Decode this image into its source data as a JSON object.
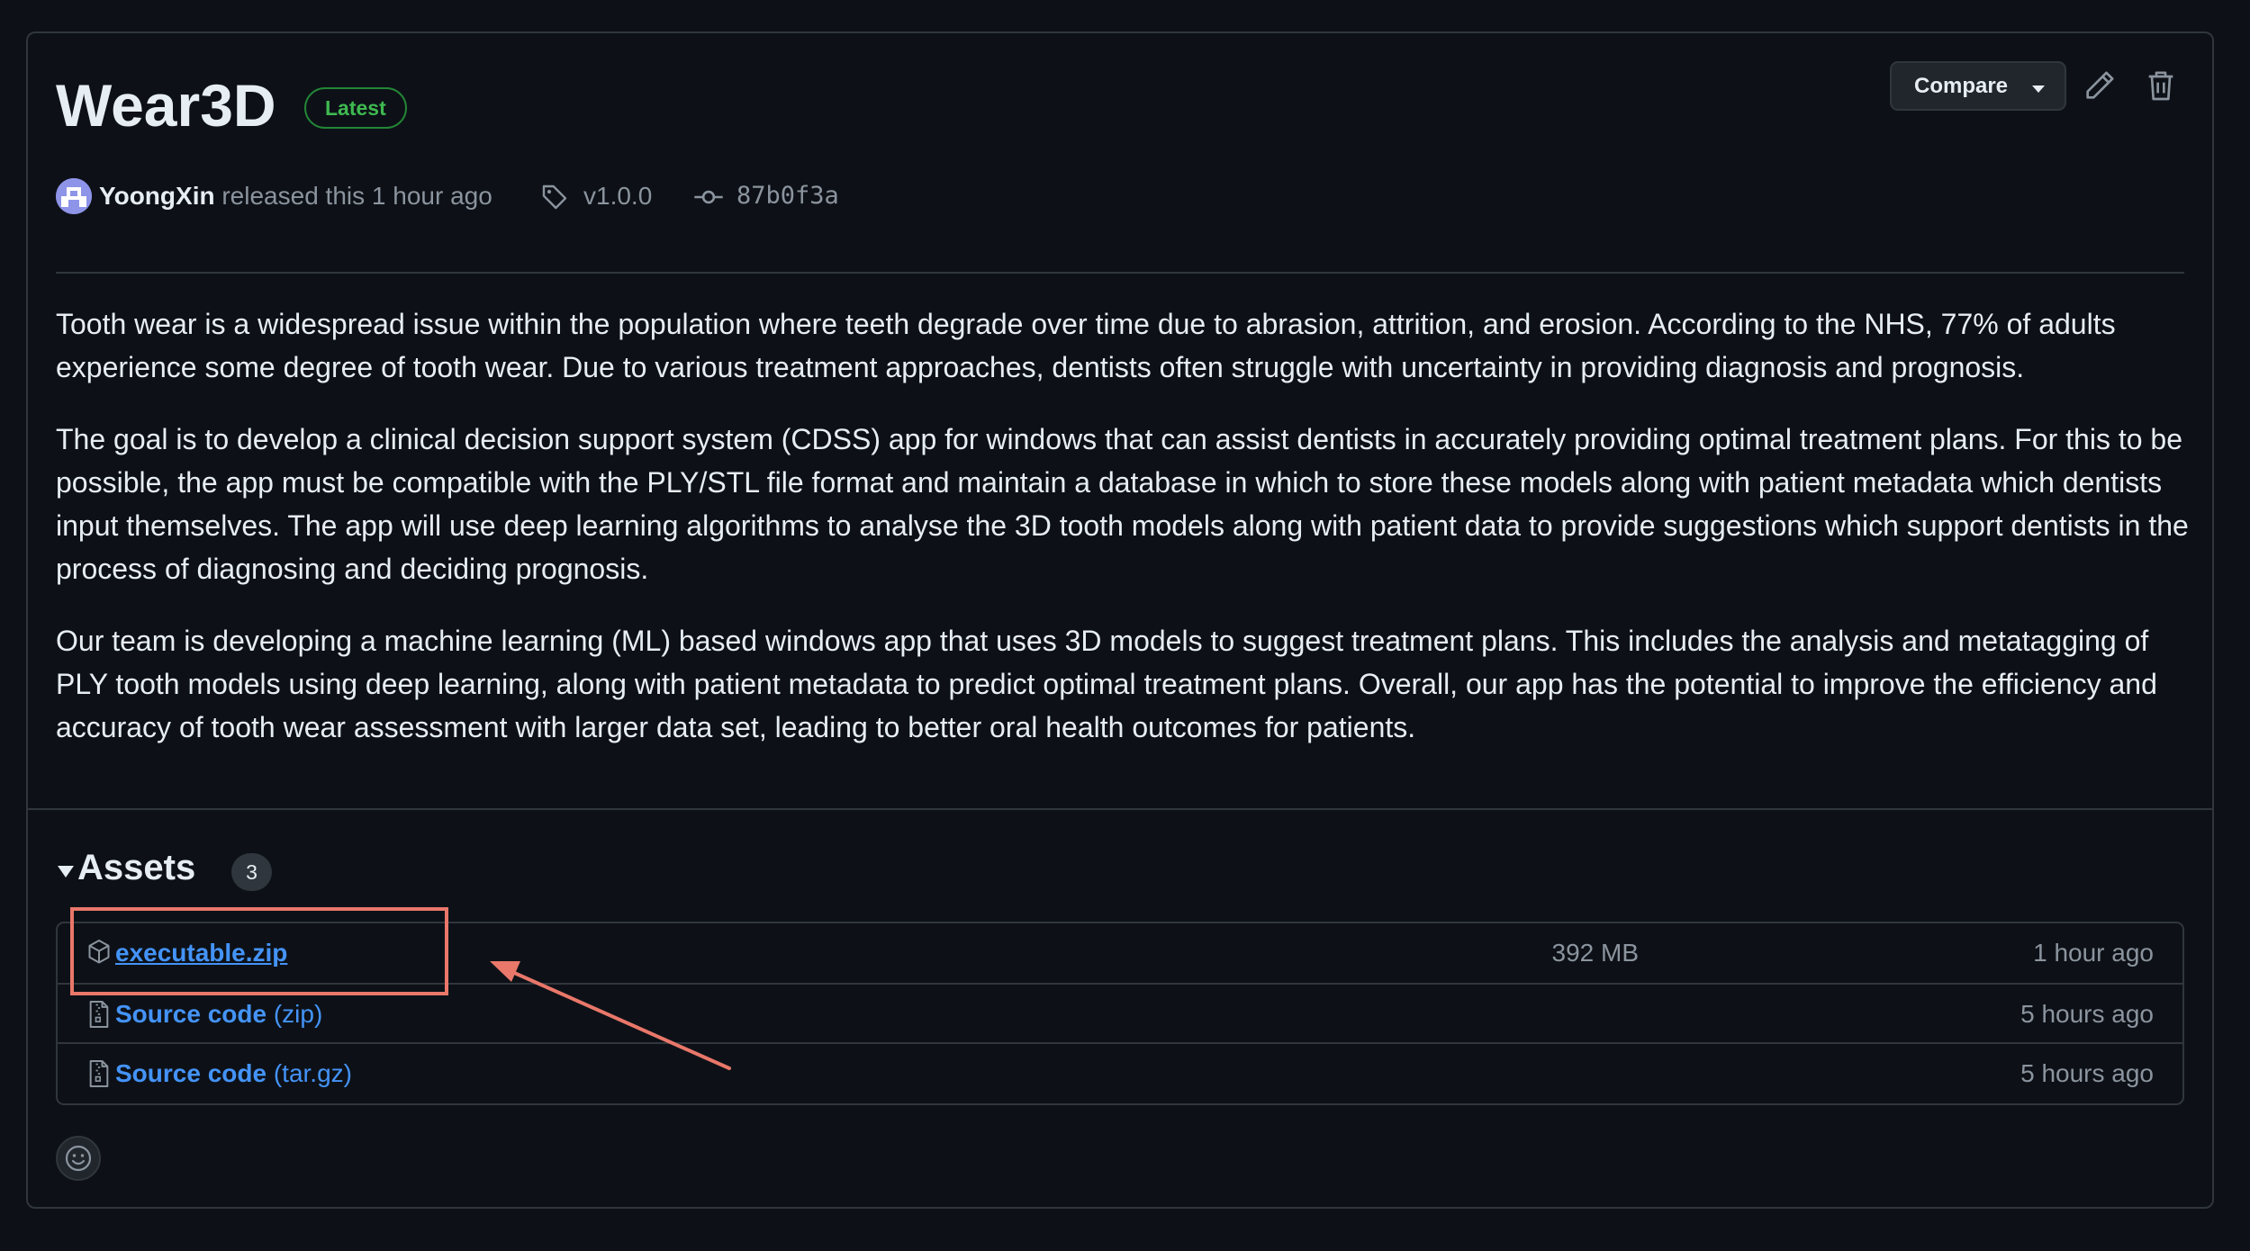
{
  "release": {
    "title": "Wear3D",
    "badge": "Latest",
    "compare_label": "Compare",
    "author": "YoongXin",
    "released_text": " released this 1 hour ago",
    "tag": "v1.0.0",
    "commit": "87b0f3a"
  },
  "description": [
    "Tooth wear is a widespread issue within the population where teeth degrade over time due to abrasion, attrition, and erosion. According to the NHS, 77% of adults experience some degree of tooth wear. Due to various treatment approaches, dentists often struggle with uncertainty in providing diagnosis and prognosis.",
    "The goal is to develop a clinical decision support system (CDSS) app for windows that can assist dentists in accurately providing optimal treatment plans. For this to be possible, the app must be compatible with the PLY/STL file format and maintain a database in which to store these models along with patient metadata which dentists input themselves. The app will use deep learning algorithms to analyse the 3D tooth models along with patient data to provide suggestions which support dentists in the process of diagnosing and deciding prognosis.",
    "Our team is developing a machine learning (ML) based windows app that uses 3D models to suggest treatment plans. This includes the analysis and metatagging of PLY tooth models using deep learning, along with patient metadata to predict optimal treatment plans. Overall, our app has the potential to improve the efficiency and accuracy of tooth wear assessment with larger data set, leading to better oral health outcomes for patients."
  ],
  "assets": {
    "heading": "Assets",
    "count": "3",
    "items": [
      {
        "name": "executable.zip",
        "ext": "",
        "size": "392 MB",
        "time": "1 hour ago",
        "icon": "package-icon"
      },
      {
        "name": "Source code",
        "ext": " (zip)",
        "size": "",
        "time": "5 hours ago",
        "icon": "file-zip-icon"
      },
      {
        "name": "Source code",
        "ext": " (tar.gz)",
        "size": "",
        "time": "5 hours ago",
        "icon": "file-zip-icon"
      }
    ]
  },
  "colors": {
    "background": "#0d1117",
    "border": "#30363d",
    "link": "#4493f8",
    "badge_green": "#3fb950",
    "annotation": "#e9776a"
  }
}
